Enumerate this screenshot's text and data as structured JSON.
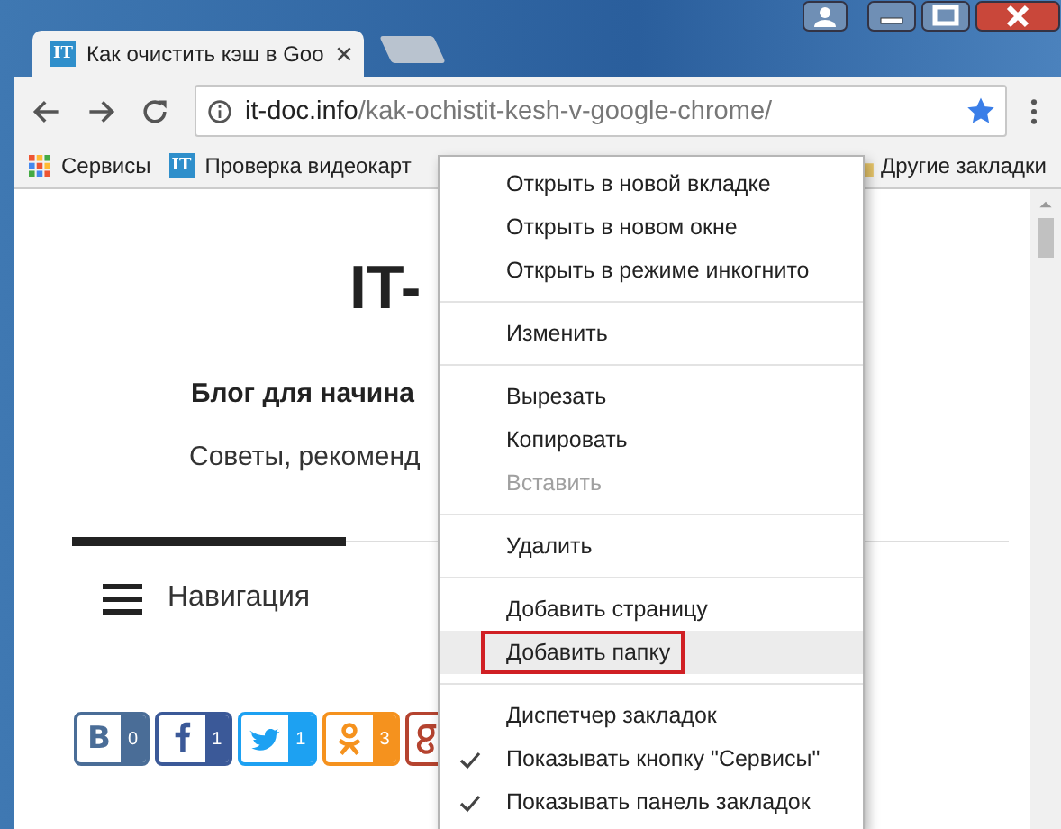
{
  "tabs": [
    {
      "title": "Как очистить кэш в Goo",
      "favicon": "IT",
      "selected": true
    }
  ],
  "address_bar": {
    "domain": "it-doc.info",
    "path": "/kak-ochistit-kesh-v-google-chrome/",
    "bookmarked": true
  },
  "bookmarks": [
    {
      "kind": "apps",
      "label": "Сервисы"
    },
    {
      "kind": "site",
      "icon": "IT",
      "label": "Проверка видеокарт"
    }
  ],
  "other_bookmarks": "Другие закладки",
  "page": {
    "title": "IT-",
    "tagline": "Блог для начина",
    "subtitle": "Советы, рекоменд",
    "nav": "Навигация",
    "social": [
      {
        "kind": "vk",
        "icon": "B",
        "count": "0",
        "color": "#4a6d97"
      },
      {
        "kind": "facebook",
        "count": "1",
        "color": "#3b5998"
      },
      {
        "kind": "twitter",
        "count": "1",
        "color": "#1da1f2"
      },
      {
        "kind": "ok",
        "count": "3",
        "color": "#f5921e"
      },
      {
        "kind": "google",
        "color": "#b5432f"
      }
    ]
  },
  "context_menu": [
    {
      "kind": "item",
      "label": "Открыть в новой вкладке",
      "disabled": false,
      "checked": false,
      "selected": false
    },
    {
      "kind": "item",
      "label": "Открыть в новом окне",
      "disabled": false,
      "checked": false,
      "selected": false
    },
    {
      "kind": "item",
      "label": "Открыть в режиме инкогнито",
      "disabled": false,
      "checked": false,
      "selected": false
    },
    {
      "kind": "separator"
    },
    {
      "kind": "item",
      "label": "Изменить",
      "disabled": false,
      "checked": false,
      "selected": false
    },
    {
      "kind": "separator"
    },
    {
      "kind": "item",
      "label": "Вырезать",
      "disabled": false,
      "checked": false,
      "selected": false
    },
    {
      "kind": "item",
      "label": "Копировать",
      "disabled": false,
      "checked": false,
      "selected": false
    },
    {
      "kind": "item",
      "label": "Вставить",
      "disabled": true,
      "checked": false,
      "selected": false
    },
    {
      "kind": "separator"
    },
    {
      "kind": "item",
      "label": "Удалить",
      "disabled": false,
      "checked": false,
      "selected": false
    },
    {
      "kind": "separator"
    },
    {
      "kind": "item",
      "label": "Добавить страницу",
      "disabled": false,
      "checked": false,
      "selected": false
    },
    {
      "kind": "item",
      "label": "Добавить папку",
      "disabled": false,
      "checked": false,
      "selected": true,
      "outlined": true
    },
    {
      "kind": "separator"
    },
    {
      "kind": "item",
      "label": "Диспетчер закладок",
      "disabled": false,
      "checked": false,
      "selected": false
    },
    {
      "kind": "item",
      "label": "Показывать кнопку \"Сервисы\"",
      "disabled": false,
      "checked": true,
      "selected": false
    },
    {
      "kind": "item",
      "label": "Показывать панель закладок",
      "disabled": false,
      "checked": true,
      "selected": false
    }
  ]
}
